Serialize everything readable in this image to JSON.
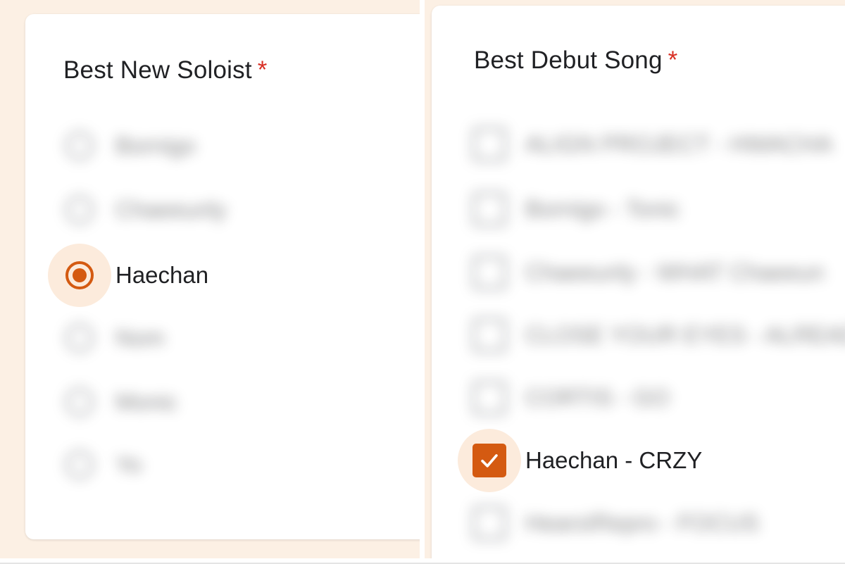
{
  "left_panel": {
    "question": {
      "title": "Best New Soloist",
      "required_mark": "*"
    },
    "options": [
      {
        "label": "Bornigo",
        "selected": false,
        "blurred": true
      },
      {
        "label": "Chaeeunly",
        "selected": false,
        "blurred": true
      },
      {
        "label": "Haechan",
        "selected": true,
        "blurred": false
      },
      {
        "label": "Nom",
        "selected": false,
        "blurred": true
      },
      {
        "label": "Monic",
        "selected": false,
        "blurred": true
      },
      {
        "label": "Yo",
        "selected": false,
        "blurred": true
      }
    ]
  },
  "right_panel": {
    "question": {
      "title": "Best Debut Song",
      "required_mark": "*"
    },
    "options": [
      {
        "label": "ALIGN PROJECT - HWACHA",
        "selected": false,
        "blurred": true
      },
      {
        "label": "Bornigo - Tonic",
        "selected": false,
        "blurred": true
      },
      {
        "label": "Chaeeunly - WHAT Chaeeun",
        "selected": false,
        "blurred": true
      },
      {
        "label": "CLOSE YOUR EYES - ALREADY",
        "selected": false,
        "blurred": true
      },
      {
        "label": "CORTIS - GO",
        "selected": false,
        "blurred": true
      },
      {
        "label": "Haechan - CRZY",
        "selected": true,
        "blurred": false
      },
      {
        "label": "HearsIRepro - FOCUS",
        "selected": false,
        "blurred": true
      }
    ]
  },
  "colors": {
    "accent": "#d45a11",
    "selection_halo": "#fcebdc",
    "required_star": "#d93025",
    "form_background": "#fcf0e4"
  }
}
